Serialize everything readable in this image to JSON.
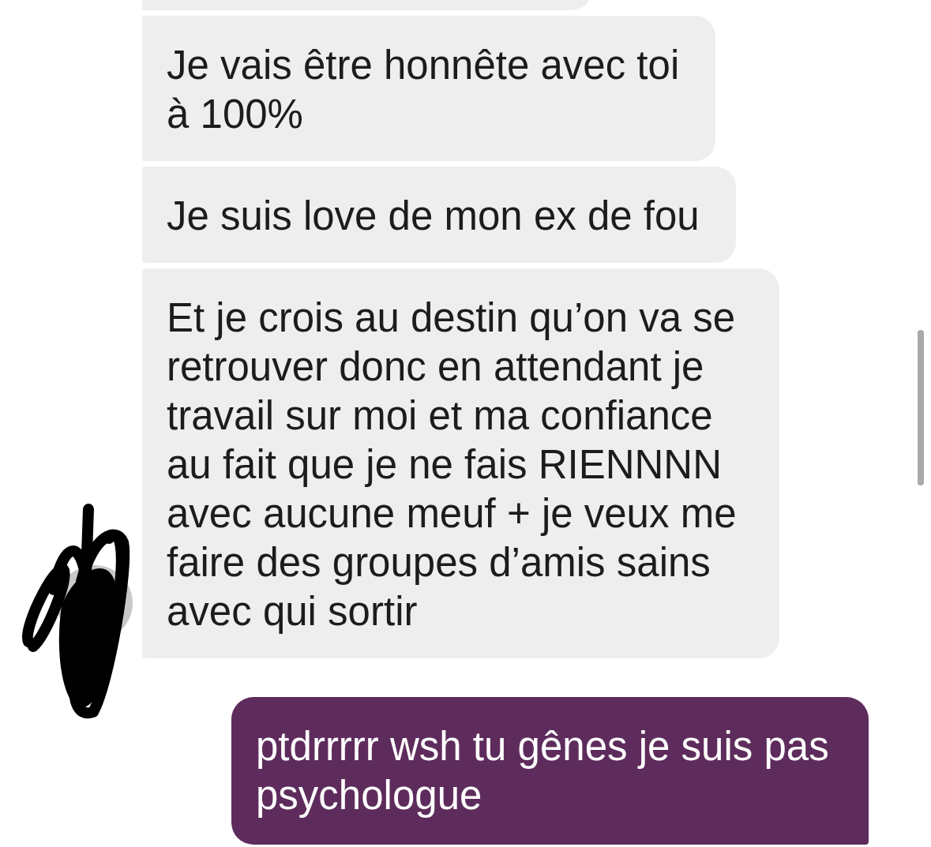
{
  "messages": [
    {
      "kind": "received",
      "cut_off": true
    },
    {
      "kind": "received",
      "cut_off": false,
      "text": "Je vais être honnête avec toi\nà 100%"
    },
    {
      "kind": "received",
      "cut_off": false,
      "text": "Je suis love de mon ex de fou"
    },
    {
      "kind": "received",
      "cut_off": false,
      "text": "Et je crois au destin qu’on va se retrouver donc en attendant je travail sur moi et ma confiance au fait que je ne fais RIENNNN avec aucune meuf + je veux me faire des groupes d’amis sains avec qui sortir",
      "avatar": {
        "redacted": true
      }
    },
    {
      "kind": "sent",
      "cut_off": false,
      "text": "ptdrrrrr wsh tu gênes je suis pas psychologue"
    }
  ]
}
